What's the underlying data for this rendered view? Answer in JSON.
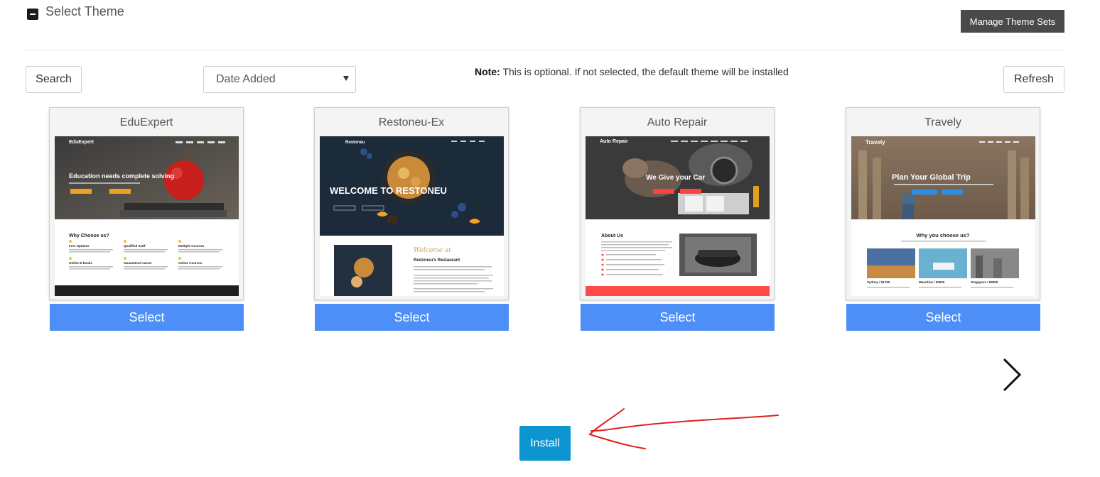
{
  "header": {
    "title": "Select Theme",
    "manage_label": "Manage Theme Sets"
  },
  "toolbar": {
    "search_label": "Search",
    "sort_value": "Date Added",
    "note_label": "Note:",
    "note_text": " This is optional. If not selected, the default theme will be installed",
    "refresh_label": "Refresh"
  },
  "themes": [
    {
      "name": "EduExpert",
      "select_label": "Select",
      "preview": {
        "brand": "EduExpert",
        "headline": "Education needs complete solving",
        "section_title": "Why Choose us?",
        "features": [
          "Free Updates",
          "Qualified Staff",
          "Multiple Courses",
          "Online E-books",
          "Guaranteed career",
          "Online Courses"
        ]
      }
    },
    {
      "name": "Restoneu-Ex",
      "select_label": "Select",
      "preview": {
        "brand": "Restoneu",
        "headline": "WELCOME TO RESTONEU",
        "welcome_script": "Welcome at",
        "section_title": "Restoneu's Restaurant"
      }
    },
    {
      "name": "Auto Repair",
      "select_label": "Select",
      "preview": {
        "brand": "Auto Repair",
        "headline": "We Give your Car",
        "section_title": "About Us"
      }
    },
    {
      "name": "Travely",
      "select_label": "Select",
      "preview": {
        "brand": "Travely",
        "headline": "Plan Your Global Trip",
        "section_title": "Why you choose us?",
        "destinations": [
          "Sydney / $1750",
          "Mauritius / $2500",
          "Singapore / $3550"
        ]
      }
    }
  ],
  "install_label": "Install",
  "colors": {
    "select_button": "#4d8ef7",
    "install_button": "#0c95d1",
    "manage_button": "#4a4a4a",
    "annotation_arrow": "#e02020"
  }
}
